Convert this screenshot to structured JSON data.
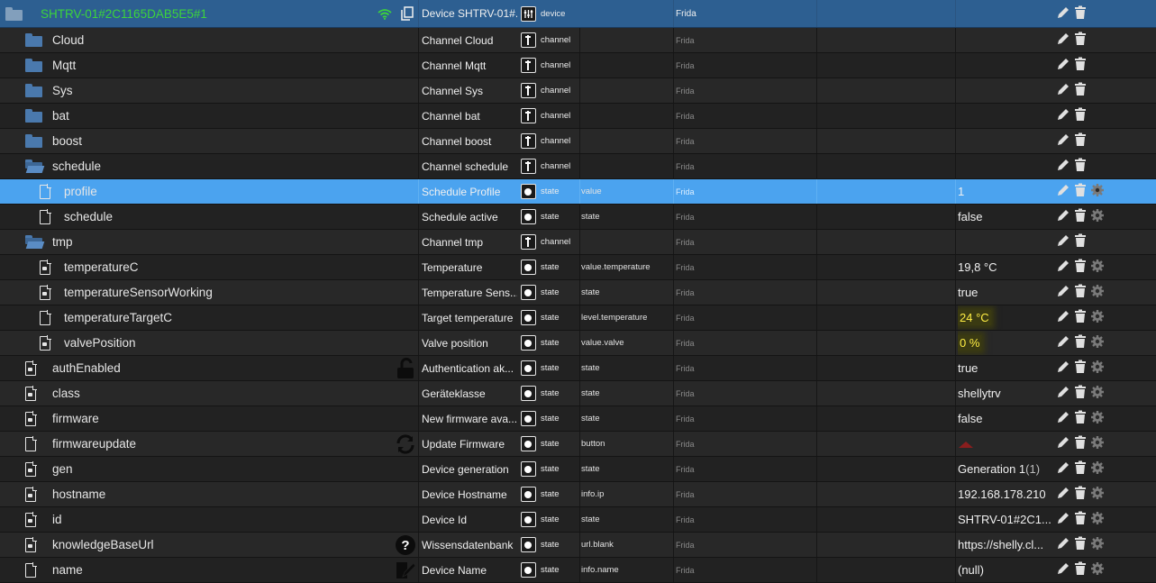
{
  "header": {
    "name": "SHTRV-01#2C1165DAB5E5#1",
    "title": "Device SHTRV-01#...",
    "type": "device",
    "room": "Frida",
    "icons": [
      "wifi-icon",
      "copy-icon"
    ]
  },
  "rows": [
    {
      "name": "Cloud",
      "indent": 1,
      "kind": "folder",
      "title": "Channel Cloud",
      "type": "channel",
      "role": "",
      "room": "Frida",
      "value": ""
    },
    {
      "name": "Mqtt",
      "indent": 1,
      "kind": "folder",
      "title": "Channel Mqtt",
      "type": "channel",
      "role": "",
      "room": "Frida",
      "value": ""
    },
    {
      "name": "Sys",
      "indent": 1,
      "kind": "folder",
      "title": "Channel Sys",
      "type": "channel",
      "role": "",
      "room": "Frida",
      "value": ""
    },
    {
      "name": "bat",
      "indent": 1,
      "kind": "folder",
      "title": "Channel bat",
      "type": "channel",
      "role": "",
      "room": "Frida",
      "value": ""
    },
    {
      "name": "boost",
      "indent": 1,
      "kind": "folder",
      "title": "Channel boost",
      "type": "channel",
      "role": "",
      "room": "Frida",
      "value": ""
    },
    {
      "name": "schedule",
      "indent": 1,
      "kind": "folder-open",
      "title": "Channel schedule",
      "type": "channel",
      "role": "",
      "room": "Frida",
      "value": ""
    },
    {
      "name": "profile",
      "indent": 2,
      "kind": "file",
      "title": "Schedule Profile",
      "type": "state",
      "role": "value",
      "room": "Frida",
      "value": "1",
      "selected": true
    },
    {
      "name": "schedule",
      "indent": 2,
      "kind": "file",
      "title": "Schedule active",
      "type": "state",
      "role": "state",
      "room": "Frida",
      "value": "false"
    },
    {
      "name": "tmp",
      "indent": 1,
      "kind": "folder-open",
      "title": "Channel tmp",
      "type": "channel",
      "role": "",
      "room": "Frida",
      "value": ""
    },
    {
      "name": "temperatureC",
      "indent": 2,
      "kind": "file-lock",
      "title": "Temperature",
      "type": "state",
      "role": "value.temperature",
      "room": "Frida",
      "value": "19,8 °C"
    },
    {
      "name": "temperatureSensorWorking",
      "indent": 2,
      "kind": "file-lock",
      "title": "Temperature Sens...",
      "type": "state",
      "role": "state",
      "room": "Frida",
      "value": "true"
    },
    {
      "name": "temperatureTargetC",
      "indent": 2,
      "kind": "file",
      "title": "Target temperature",
      "type": "state",
      "role": "level.temperature",
      "room": "Frida",
      "value": "24 °C",
      "highlight": true
    },
    {
      "name": "valvePosition",
      "indent": 2,
      "kind": "file-lock",
      "title": "Valve position",
      "type": "state",
      "role": "value.valve",
      "room": "Frida",
      "value": "0 %",
      "highlight": true
    },
    {
      "name": "authEnabled",
      "indent": 1,
      "kind": "file-lock",
      "title": "Authentication ak...",
      "type": "state",
      "role": "state",
      "room": "Frida",
      "value": "true",
      "side": "unlock-icon"
    },
    {
      "name": "class",
      "indent": 1,
      "kind": "file-lock",
      "title": "Geräteklasse",
      "type": "state",
      "role": "state",
      "room": "Frida",
      "value": "shellytrv"
    },
    {
      "name": "firmware",
      "indent": 1,
      "kind": "file-lock",
      "title": "New firmware ava...",
      "type": "state",
      "role": "state",
      "room": "Frida",
      "value": "false"
    },
    {
      "name": "firmwareupdate",
      "indent": 1,
      "kind": "file",
      "title": "Update Firmware",
      "type": "state",
      "role": "button",
      "room": "Frida",
      "value": "",
      "side": "refresh-icon",
      "button": true
    },
    {
      "name": "gen",
      "indent": 1,
      "kind": "file-lock",
      "title": "Device generation",
      "type": "state",
      "role": "state",
      "room": "Frida",
      "value": "Generation 1",
      "value_suffix": "(1)"
    },
    {
      "name": "hostname",
      "indent": 1,
      "kind": "file-lock",
      "title": "Device Hostname",
      "type": "state",
      "role": "info.ip",
      "room": "Frida",
      "value": "192.168.178.210"
    },
    {
      "name": "id",
      "indent": 1,
      "kind": "file-lock",
      "title": "Device Id",
      "type": "state",
      "role": "state",
      "room": "Frida",
      "value": "SHTRV-01#2C1..."
    },
    {
      "name": "knowledgeBaseUrl",
      "indent": 1,
      "kind": "file-lock",
      "title": "Wissensdatenbank",
      "type": "state",
      "role": "url.blank",
      "room": "Frida",
      "value": "https://shelly.cl...",
      "side": "help-icon"
    },
    {
      "name": "name",
      "indent": 1,
      "kind": "file",
      "title": "Device Name",
      "type": "state",
      "role": "info.name",
      "room": "Frida",
      "value": "(null)",
      "side": "edit-name-icon"
    }
  ]
}
